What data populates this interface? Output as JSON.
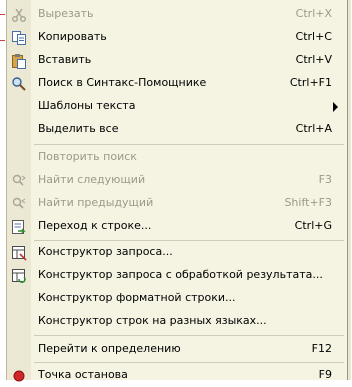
{
  "menu": {
    "items": [
      {
        "label": "Вырезать",
        "underline": "В",
        "shortcut": "Ctrl+X",
        "disabled": true,
        "icon": "scissors-icon"
      },
      {
        "label": "Копировать",
        "underline": "К",
        "shortcut": "Ctrl+C",
        "disabled": false,
        "icon": "copy-icon"
      },
      {
        "label": "Вставить",
        "underline": "В",
        "shortcut": "Ctrl+V",
        "disabled": false,
        "icon": "paste-icon"
      },
      {
        "label": "Поиск в Синтакс-Помощнике",
        "shortcut": "Ctrl+F1",
        "disabled": false,
        "icon": "syntax-search-icon"
      },
      {
        "label": "Шаблоны текста",
        "shortcut": "",
        "disabled": false,
        "submenu": true
      },
      {
        "label": "Выделить все",
        "shortcut": "Ctrl+A",
        "disabled": false
      },
      {
        "label": "Повторить поиск",
        "shortcut": "",
        "disabled": true
      },
      {
        "label": "Найти следующий",
        "shortcut": "F3",
        "disabled": true,
        "icon": "find-next-icon"
      },
      {
        "label": "Найти предыдущий",
        "shortcut": "Shift+F3",
        "disabled": true,
        "icon": "find-previous-icon"
      },
      {
        "label": "Переход к строке...",
        "shortcut": "Ctrl+G",
        "disabled": false,
        "icon": "goto-line-icon"
      },
      {
        "label": "Конструктор запроса...",
        "shortcut": "",
        "disabled": false,
        "icon": "query-builder-icon"
      },
      {
        "label": "Конструктор запроса с обработкой результата...",
        "shortcut": "",
        "disabled": false,
        "icon": "query-builder-result-icon"
      },
      {
        "label": "Конструктор форматной строки...",
        "shortcut": "",
        "disabled": false
      },
      {
        "label": "Конструктор строк на разных языках...",
        "shortcut": "",
        "disabled": false
      },
      {
        "label": "Перейти к определению",
        "shortcut": "F12",
        "disabled": false
      },
      {
        "label": "Точка останова",
        "shortcut": "F9",
        "disabled": false,
        "icon": "breakpoint-icon"
      }
    ]
  },
  "colors": {
    "menu_bg": "#f5f3e2",
    "icon_column": "#ebe8d3",
    "disabled_text": "#9b9988",
    "separator": "#cfcbb4"
  }
}
